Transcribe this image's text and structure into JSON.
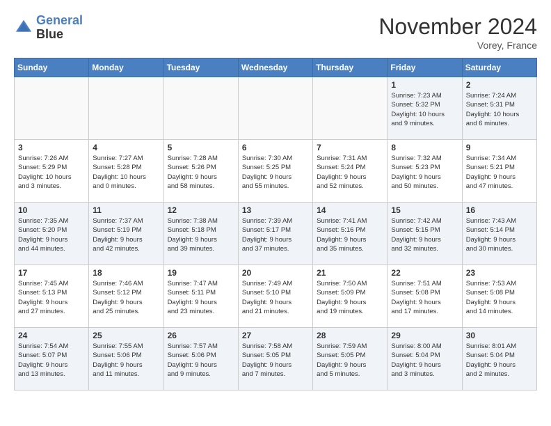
{
  "header": {
    "logo_line1": "General",
    "logo_line2": "Blue",
    "month": "November 2024",
    "location": "Vorey, France"
  },
  "weekdays": [
    "Sunday",
    "Monday",
    "Tuesday",
    "Wednesday",
    "Thursday",
    "Friday",
    "Saturday"
  ],
  "weeks": [
    [
      {
        "day": "",
        "info": "",
        "empty": true
      },
      {
        "day": "",
        "info": "",
        "empty": true
      },
      {
        "day": "",
        "info": "",
        "empty": true
      },
      {
        "day": "",
        "info": "",
        "empty": true
      },
      {
        "day": "",
        "info": "",
        "empty": true
      },
      {
        "day": "1",
        "info": "Sunrise: 7:23 AM\nSunset: 5:32 PM\nDaylight: 10 hours\nand 9 minutes."
      },
      {
        "day": "2",
        "info": "Sunrise: 7:24 AM\nSunset: 5:31 PM\nDaylight: 10 hours\nand 6 minutes."
      }
    ],
    [
      {
        "day": "3",
        "info": "Sunrise: 7:26 AM\nSunset: 5:29 PM\nDaylight: 10 hours\nand 3 minutes."
      },
      {
        "day": "4",
        "info": "Sunrise: 7:27 AM\nSunset: 5:28 PM\nDaylight: 10 hours\nand 0 minutes."
      },
      {
        "day": "5",
        "info": "Sunrise: 7:28 AM\nSunset: 5:26 PM\nDaylight: 9 hours\nand 58 minutes."
      },
      {
        "day": "6",
        "info": "Sunrise: 7:30 AM\nSunset: 5:25 PM\nDaylight: 9 hours\nand 55 minutes."
      },
      {
        "day": "7",
        "info": "Sunrise: 7:31 AM\nSunset: 5:24 PM\nDaylight: 9 hours\nand 52 minutes."
      },
      {
        "day": "8",
        "info": "Sunrise: 7:32 AM\nSunset: 5:23 PM\nDaylight: 9 hours\nand 50 minutes."
      },
      {
        "day": "9",
        "info": "Sunrise: 7:34 AM\nSunset: 5:21 PM\nDaylight: 9 hours\nand 47 minutes."
      }
    ],
    [
      {
        "day": "10",
        "info": "Sunrise: 7:35 AM\nSunset: 5:20 PM\nDaylight: 9 hours\nand 44 minutes."
      },
      {
        "day": "11",
        "info": "Sunrise: 7:37 AM\nSunset: 5:19 PM\nDaylight: 9 hours\nand 42 minutes."
      },
      {
        "day": "12",
        "info": "Sunrise: 7:38 AM\nSunset: 5:18 PM\nDaylight: 9 hours\nand 39 minutes."
      },
      {
        "day": "13",
        "info": "Sunrise: 7:39 AM\nSunset: 5:17 PM\nDaylight: 9 hours\nand 37 minutes."
      },
      {
        "day": "14",
        "info": "Sunrise: 7:41 AM\nSunset: 5:16 PM\nDaylight: 9 hours\nand 35 minutes."
      },
      {
        "day": "15",
        "info": "Sunrise: 7:42 AM\nSunset: 5:15 PM\nDaylight: 9 hours\nand 32 minutes."
      },
      {
        "day": "16",
        "info": "Sunrise: 7:43 AM\nSunset: 5:14 PM\nDaylight: 9 hours\nand 30 minutes."
      }
    ],
    [
      {
        "day": "17",
        "info": "Sunrise: 7:45 AM\nSunset: 5:13 PM\nDaylight: 9 hours\nand 27 minutes."
      },
      {
        "day": "18",
        "info": "Sunrise: 7:46 AM\nSunset: 5:12 PM\nDaylight: 9 hours\nand 25 minutes."
      },
      {
        "day": "19",
        "info": "Sunrise: 7:47 AM\nSunset: 5:11 PM\nDaylight: 9 hours\nand 23 minutes."
      },
      {
        "day": "20",
        "info": "Sunrise: 7:49 AM\nSunset: 5:10 PM\nDaylight: 9 hours\nand 21 minutes."
      },
      {
        "day": "21",
        "info": "Sunrise: 7:50 AM\nSunset: 5:09 PM\nDaylight: 9 hours\nand 19 minutes."
      },
      {
        "day": "22",
        "info": "Sunrise: 7:51 AM\nSunset: 5:08 PM\nDaylight: 9 hours\nand 17 minutes."
      },
      {
        "day": "23",
        "info": "Sunrise: 7:53 AM\nSunset: 5:08 PM\nDaylight: 9 hours\nand 14 minutes."
      }
    ],
    [
      {
        "day": "24",
        "info": "Sunrise: 7:54 AM\nSunset: 5:07 PM\nDaylight: 9 hours\nand 13 minutes."
      },
      {
        "day": "25",
        "info": "Sunrise: 7:55 AM\nSunset: 5:06 PM\nDaylight: 9 hours\nand 11 minutes."
      },
      {
        "day": "26",
        "info": "Sunrise: 7:57 AM\nSunset: 5:06 PM\nDaylight: 9 hours\nand 9 minutes."
      },
      {
        "day": "27",
        "info": "Sunrise: 7:58 AM\nSunset: 5:05 PM\nDaylight: 9 hours\nand 7 minutes."
      },
      {
        "day": "28",
        "info": "Sunrise: 7:59 AM\nSunset: 5:05 PM\nDaylight: 9 hours\nand 5 minutes."
      },
      {
        "day": "29",
        "info": "Sunrise: 8:00 AM\nSunset: 5:04 PM\nDaylight: 9 hours\nand 3 minutes."
      },
      {
        "day": "30",
        "info": "Sunrise: 8:01 AM\nSunset: 5:04 PM\nDaylight: 9 hours\nand 2 minutes."
      }
    ]
  ]
}
